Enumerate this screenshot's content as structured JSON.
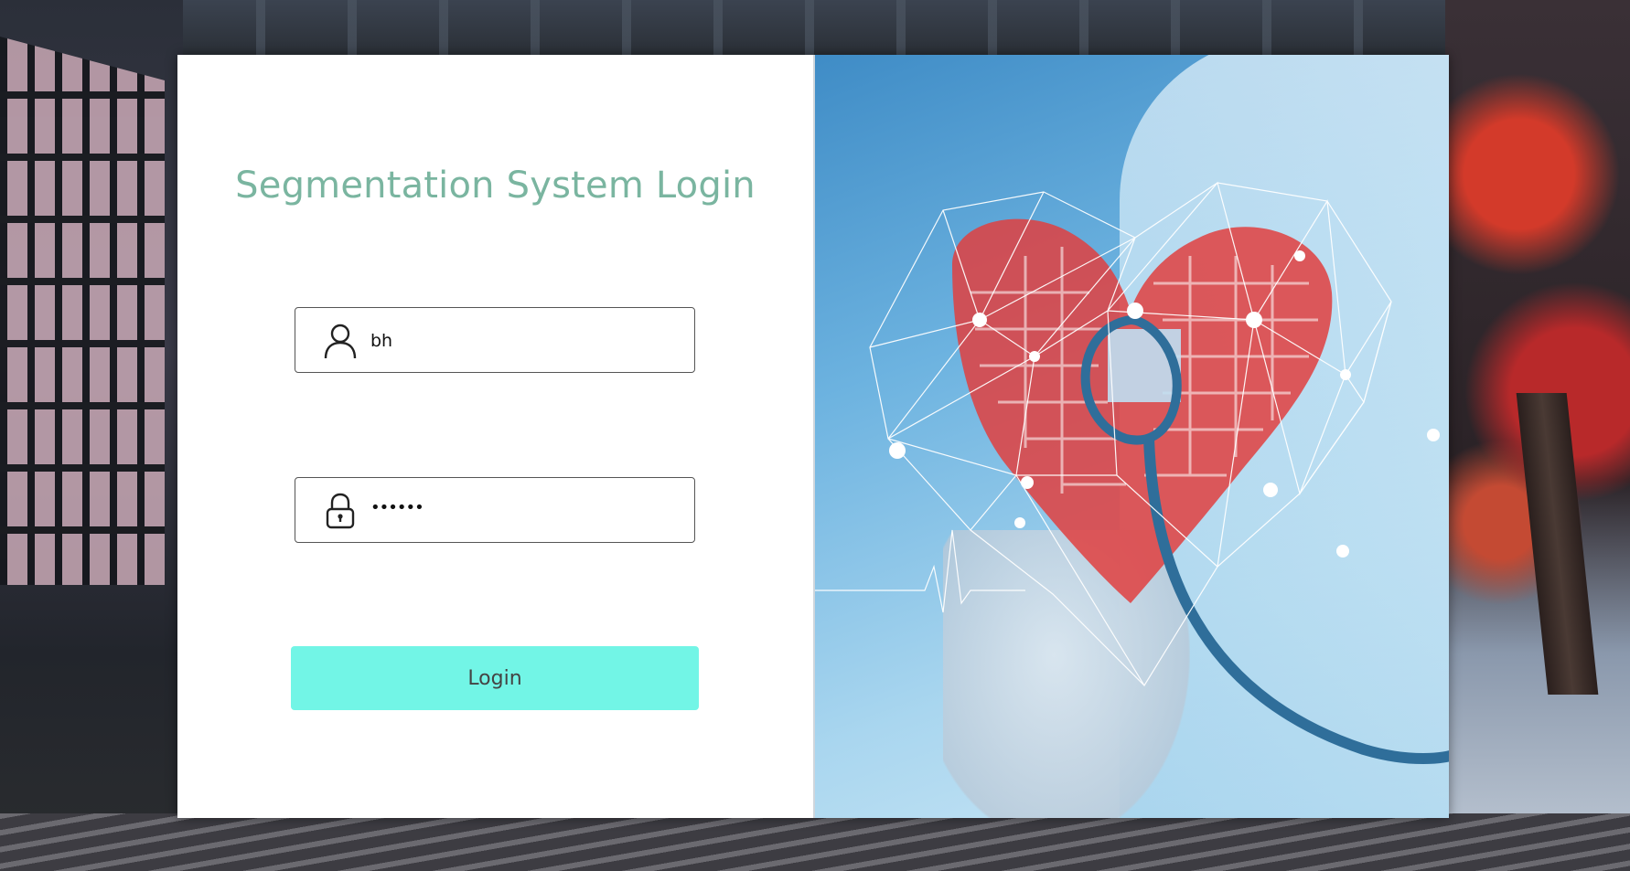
{
  "window": {
    "title": "Segmentation System Login"
  },
  "form": {
    "username": {
      "icon": "user-icon",
      "value": "bh"
    },
    "password": {
      "icon": "lock-icon",
      "value": "••••••"
    },
    "login_label": "Login"
  },
  "colors": {
    "title": "#7ab5a0",
    "login_button": "#72f5e6",
    "circuit_heart": "#e04040",
    "panel_background": "#ffffff"
  },
  "illustration": {
    "icon": "medical-heart-circuit-illustration"
  }
}
